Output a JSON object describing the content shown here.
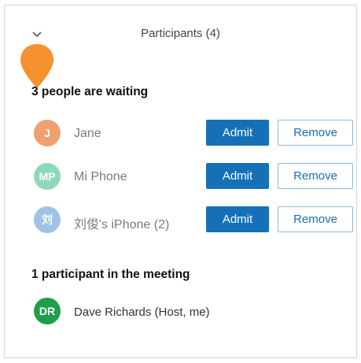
{
  "header": {
    "title": "Participants (4)",
    "collapse_icon": "chevron-down-icon"
  },
  "waiting": {
    "title": "3 people are waiting",
    "admit_label": "Admit",
    "remove_label": "Remove",
    "people": [
      {
        "initials": "J",
        "name": "Jane",
        "avatar_color": "#f0a070"
      },
      {
        "initials": "MP",
        "name": "Mi Phone",
        "avatar_color": "#8fd9b8"
      },
      {
        "initials": "刘",
        "name": "刘俊's iPhone (2)",
        "avatar_color": "#9ec3e6"
      }
    ]
  },
  "in_meeting": {
    "title": "1 participant in the meeting",
    "people": [
      {
        "initials": "DR",
        "name": "Dave Richards (Host, me)",
        "avatar_color": "#1e9e4a"
      }
    ]
  },
  "colors": {
    "accent": "#1570b8",
    "pin": "#f5922f"
  }
}
